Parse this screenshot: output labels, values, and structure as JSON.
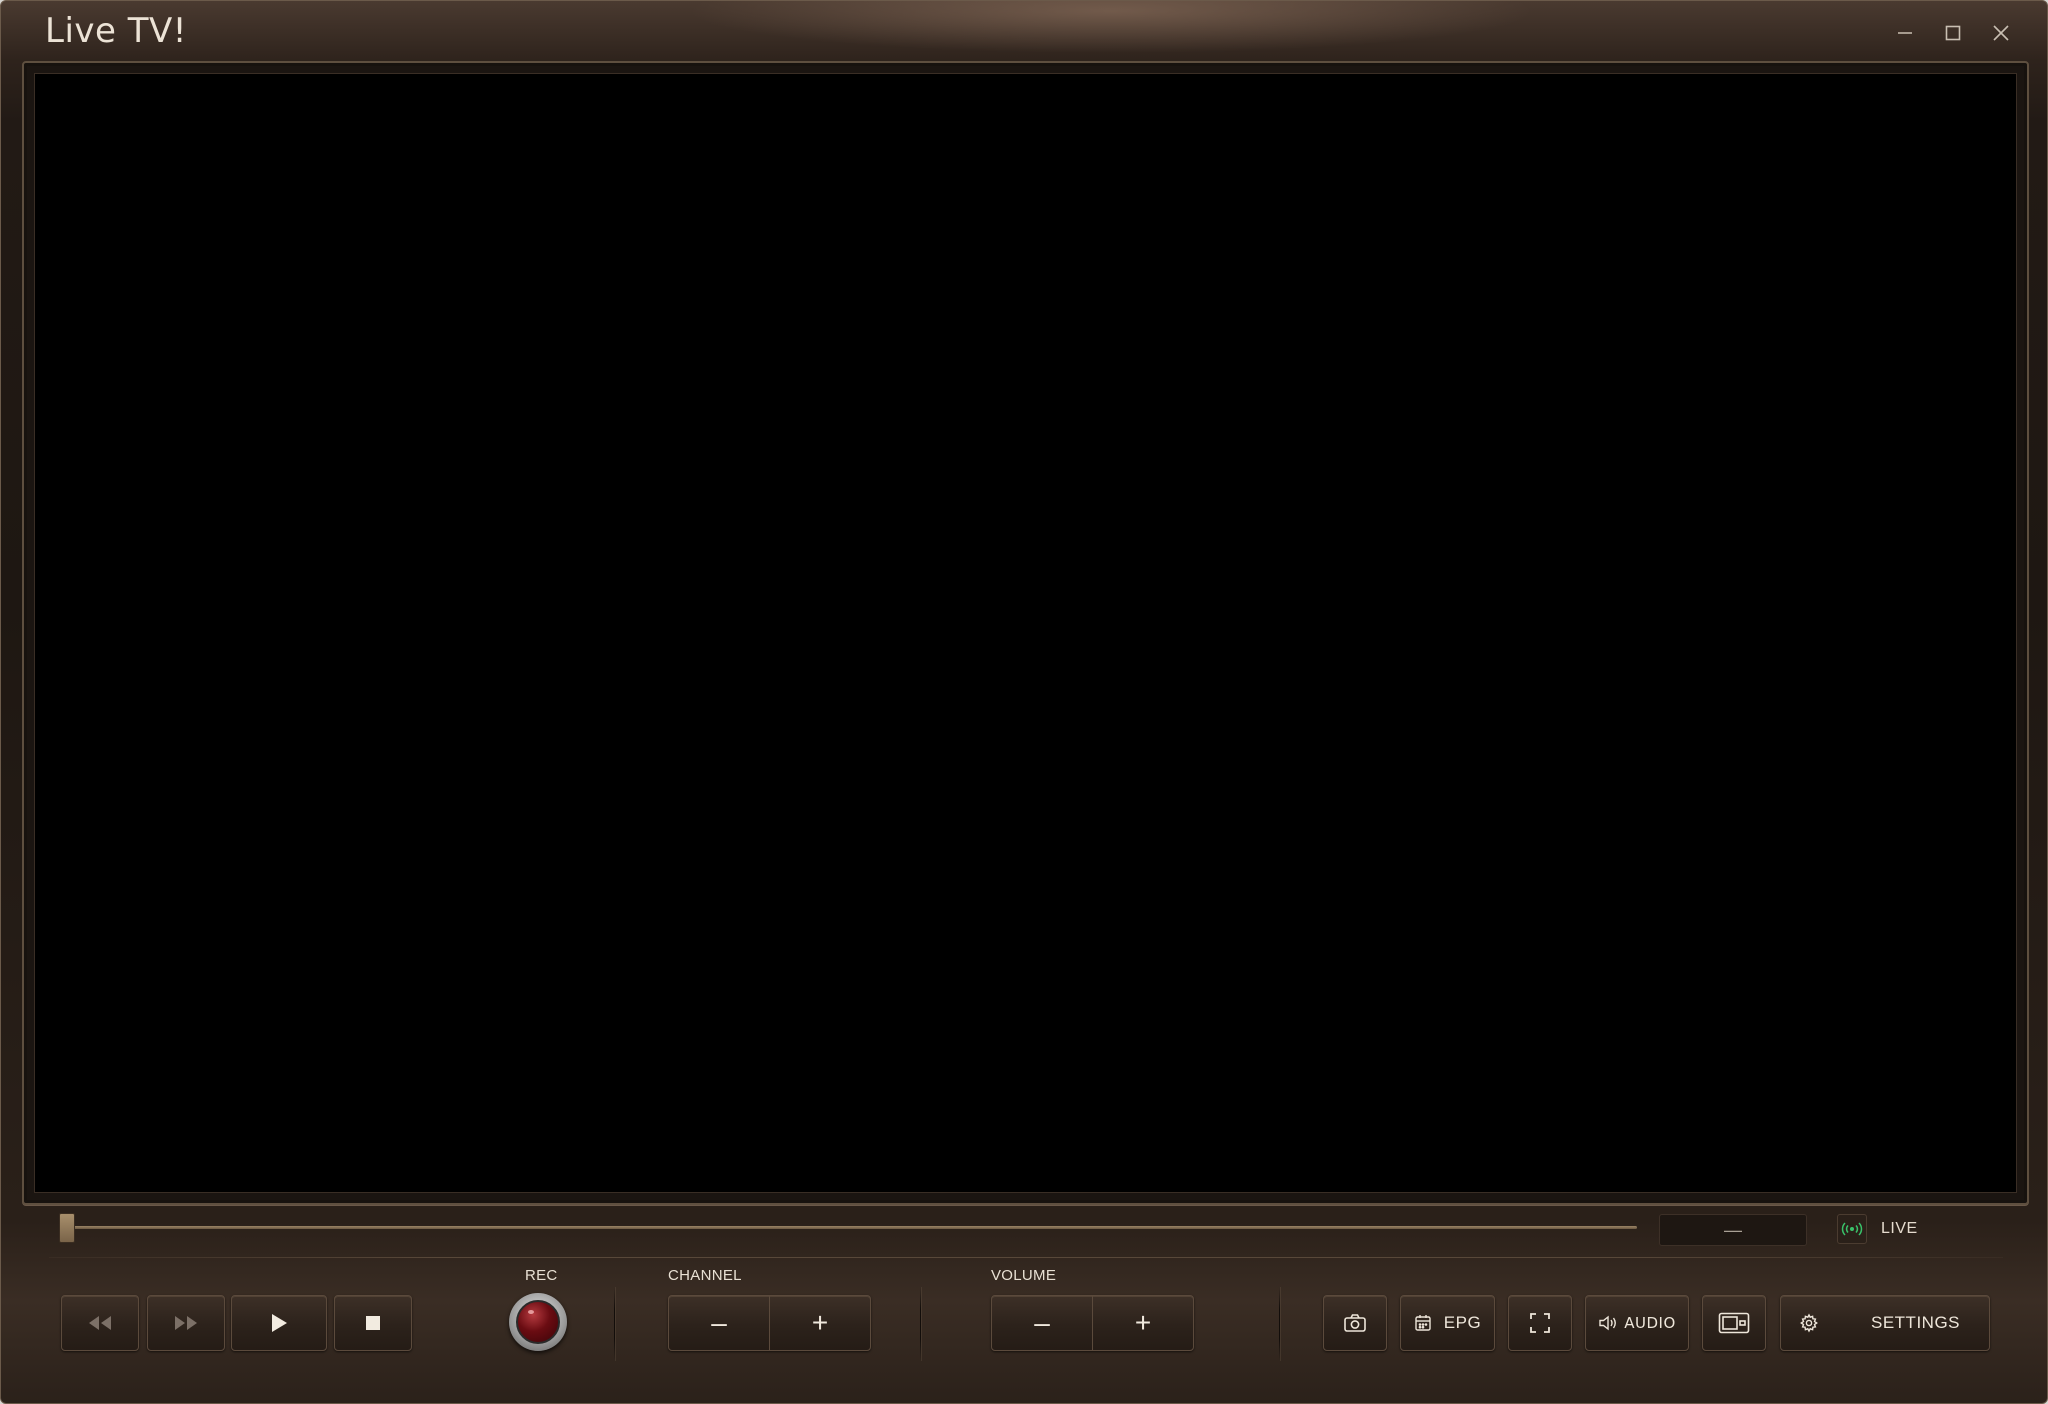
{
  "window": {
    "title": "Live TV!",
    "controls": [
      "minimize-icon",
      "maximize-icon",
      "close-icon"
    ]
  },
  "progress": {
    "position_fraction": 0.0,
    "time_text": "—",
    "live_label": "LIVE",
    "live_icon": "broadcast-icon"
  },
  "playback": {
    "buttons": [
      {
        "icon": "rewind-icon",
        "enabled": false
      },
      {
        "icon": "fast-forward-icon",
        "enabled": false
      },
      {
        "icon": "play-icon",
        "enabled": true
      },
      {
        "icon": "stop-icon",
        "enabled": true
      }
    ]
  },
  "rec": {
    "label": "REC"
  },
  "channel": {
    "label": "CHANNEL",
    "minus": "–",
    "plus": "+"
  },
  "volume": {
    "label": "VOLUME",
    "minus": "–",
    "plus": "+"
  },
  "toolbar": {
    "snapshot_icon": "camera-icon",
    "epg_label": "EPG",
    "epg_icon": "calendar-icon",
    "fullscreen_icon": "fullscreen-icon",
    "audio_label": "AUDIO",
    "audio_icon": "speaker-icon",
    "pip_icon": "picture-in-picture-icon",
    "settings_label": "SETTINGS",
    "settings_icon": "gear-icon"
  },
  "colors": {
    "accent": "#9b8466",
    "live_indicator": "#39c26a",
    "rec_red": "#6a0c12"
  }
}
